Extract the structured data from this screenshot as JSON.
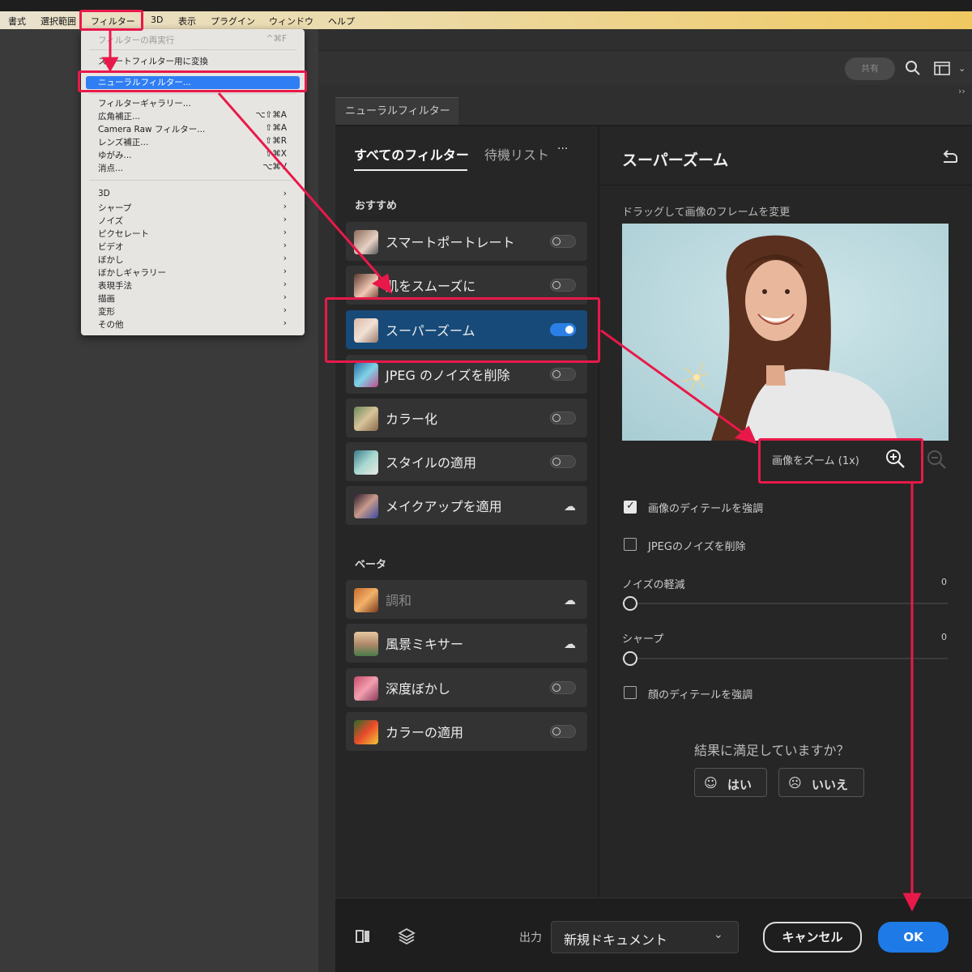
{
  "menubar": {
    "items": [
      "書式",
      "選択範囲",
      "フィルター",
      "3D",
      "表示",
      "プラグイン",
      "ウィンドウ",
      "ヘルプ"
    ]
  },
  "menu": {
    "items": [
      {
        "label": "フィルターの再実行",
        "shortcut": "^⌘F",
        "disabled": true
      },
      {
        "label": "スマートフィルター用に変換",
        "shortcut": ""
      },
      {
        "label": "ニューラルフィルター...",
        "shortcut": "",
        "highlighted": true
      },
      {
        "label": "フィルターギャラリー...",
        "shortcut": ""
      },
      {
        "label": "広角補正...",
        "shortcut": "⌥⇧⌘A"
      },
      {
        "label": "Camera Raw フィルター...",
        "shortcut": "⇧⌘A"
      },
      {
        "label": "レンズ補正...",
        "shortcut": "⇧⌘R"
      },
      {
        "label": "ゆがみ...",
        "shortcut": "⇧⌘X"
      },
      {
        "label": "消点...",
        "shortcut": "⌥⌘V"
      },
      {
        "label": "3D",
        "shortcut": "›"
      },
      {
        "label": "シャープ",
        "shortcut": "›"
      },
      {
        "label": "ノイズ",
        "shortcut": "›"
      },
      {
        "label": "ピクセレート",
        "shortcut": "›"
      },
      {
        "label": "ビデオ",
        "shortcut": "›"
      },
      {
        "label": "ぼかし",
        "shortcut": "›"
      },
      {
        "label": "ぼかしギャラリー",
        "shortcut": "›"
      },
      {
        "label": "表現手法",
        "shortcut": "›"
      },
      {
        "label": "描画",
        "shortcut": "›"
      },
      {
        "label": "変形",
        "shortcut": "›"
      },
      {
        "label": "その他",
        "shortcut": "›"
      }
    ]
  },
  "toolbar": {
    "share_label": "共有",
    "expand_glyph": "››"
  },
  "panel": {
    "tab_title": "ニューラルフィルター",
    "tabs": {
      "all": "すべてのフィルター",
      "waitlist": "待機リスト",
      "more": "···"
    },
    "featured_heading": "おすすめ",
    "beta_heading": "ベータ",
    "filters": [
      {
        "label": "スマートポートレート",
        "control": "toggle",
        "on": false
      },
      {
        "label": "肌をスムーズに",
        "control": "toggle",
        "on": false
      },
      {
        "label": "スーパーズーム",
        "control": "toggle",
        "on": true
      },
      {
        "label": "JPEG のノイズを削除",
        "control": "toggle",
        "on": false
      },
      {
        "label": "カラー化",
        "control": "toggle",
        "on": false
      },
      {
        "label": "スタイルの適用",
        "control": "toggle",
        "on": false
      },
      {
        "label": "メイクアップを適用",
        "control": "cloud"
      }
    ],
    "beta_filters": [
      {
        "label": "調和",
        "control": "cloud",
        "dim": true
      },
      {
        "label": "風景ミキサー",
        "control": "cloud"
      },
      {
        "label": "深度ぼかし",
        "control": "toggle",
        "on": false
      },
      {
        "label": "カラーの適用",
        "control": "toggle",
        "on": false
      }
    ]
  },
  "detail": {
    "title": "スーパーズーム",
    "drag_hint": "ドラッグして画像のフレームを変更",
    "zoom_label": "画像をズーム (1x)",
    "enhance_detail": "画像のディテールを強調",
    "remove_jpeg_noise": "JPEGのノイズを削除",
    "noise_label": "ノイズの軽減",
    "noise_value": "0",
    "sharpen_label": "シャープ",
    "sharpen_value": "0",
    "face_detail": "顔のディテールを強調",
    "satisfaction_q": "結果に満足していますか？",
    "yes": "はい",
    "no": "いいえ"
  },
  "footer": {
    "output_label": "出力",
    "output_value": "新規ドキュメント",
    "cancel": "キャンセル",
    "ok": "OK"
  },
  "colors": {
    "accent": "#2b80e6",
    "annotation": "#e8194a",
    "menu_highlight": "#2f7ef3"
  }
}
